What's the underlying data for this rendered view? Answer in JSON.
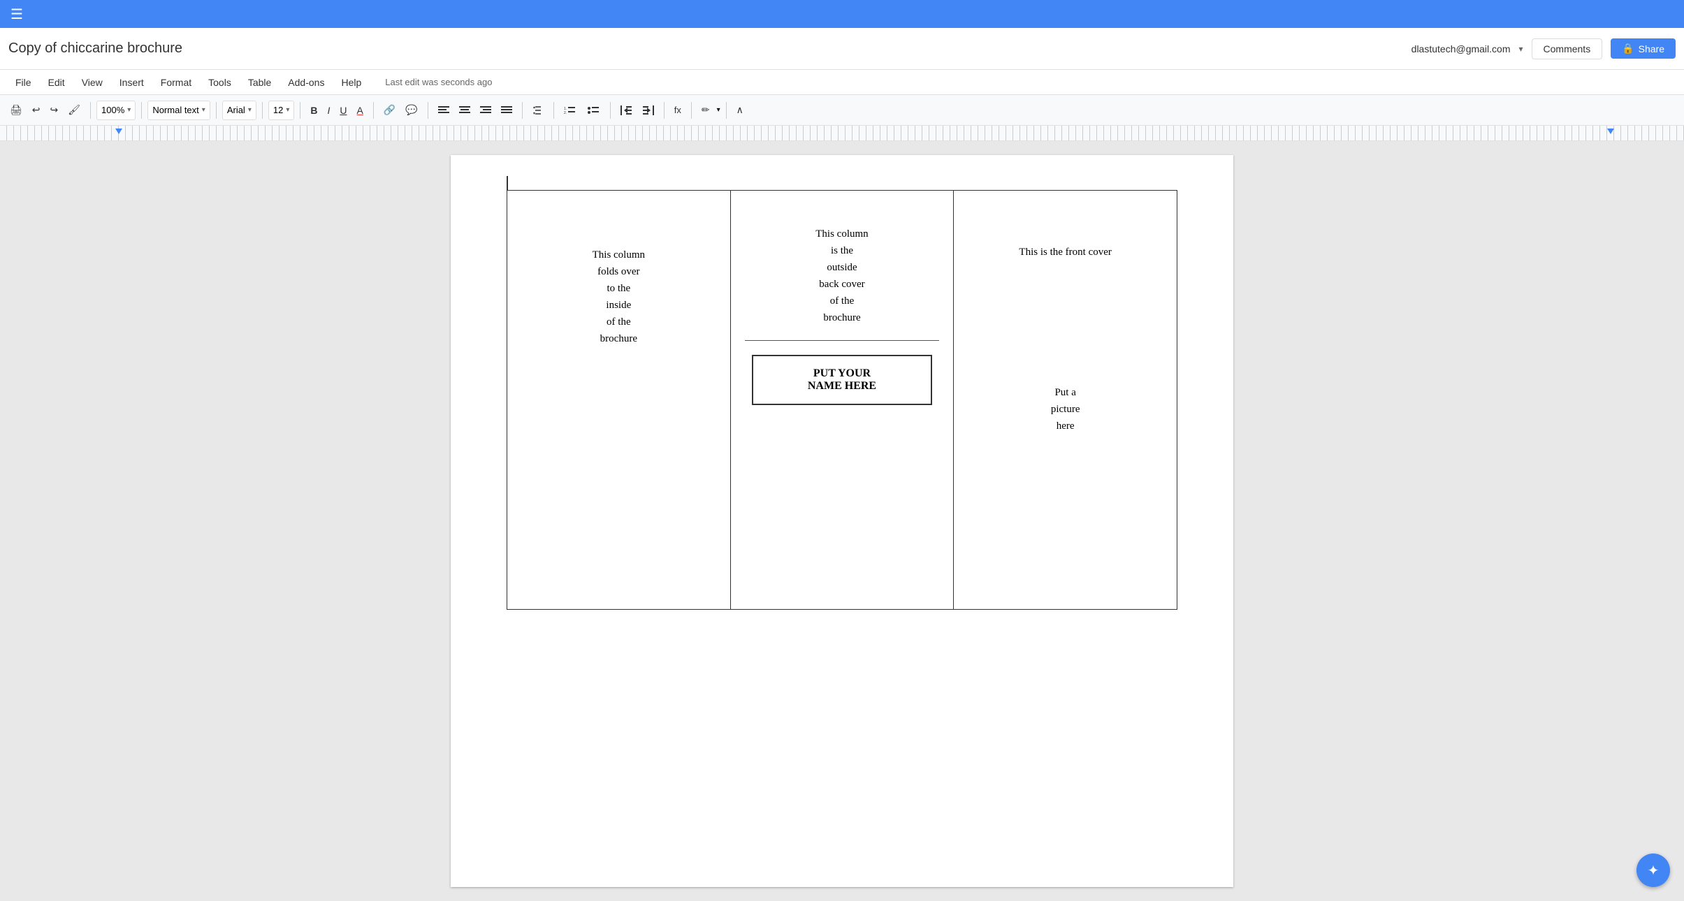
{
  "app": {
    "title": "Copy of chiccarine brochure",
    "user_email": "dlastutech@gmail.com",
    "last_edit": "Last edit was seconds ago"
  },
  "title_icons": {
    "star": "☆",
    "folder": "🗀"
  },
  "top_bar": {
    "hamburger": "☰"
  },
  "header_buttons": {
    "comments": "Comments",
    "share": "Share"
  },
  "menu": {
    "items": [
      "File",
      "Edit",
      "View",
      "Insert",
      "Format",
      "Tools",
      "Table",
      "Add-ons",
      "Help"
    ]
  },
  "toolbar": {
    "print": "🖨",
    "undo": "↩",
    "redo": "↪",
    "paint": "🖌",
    "zoom": "100%",
    "zoom_arrow": "▾",
    "style": "Normal text",
    "style_arrow": "▾",
    "font": "Arial",
    "font_arrow": "▾",
    "size": "12",
    "size_arrow": "▾",
    "bold": "B",
    "italic": "I",
    "underline": "U",
    "text_color": "A",
    "link": "🔗",
    "comment_inline": "💬",
    "align_left": "≡",
    "align_center": "≡",
    "align_right": "≡",
    "align_justify": "≡",
    "line_spacing": "↕",
    "numbered_list": "1.",
    "bulleted_list": "•",
    "indent_less": "⇐",
    "indent_more": "⇒",
    "formula": "fx",
    "pen": "✏",
    "collapse": "∧"
  },
  "brochure": {
    "col1": {
      "text": "This column\nfolds over\nto the\ninside\nof the\nbrochure"
    },
    "col2": {
      "back_text": "This column\nis the\noutside\nback cover\nof the\nbrochure",
      "name_line1": "PUT YOUR",
      "name_line2": "NAME HERE"
    },
    "col3": {
      "front_text": "This is the front cover",
      "picture_text": "Put a\npicture\nhere"
    }
  }
}
